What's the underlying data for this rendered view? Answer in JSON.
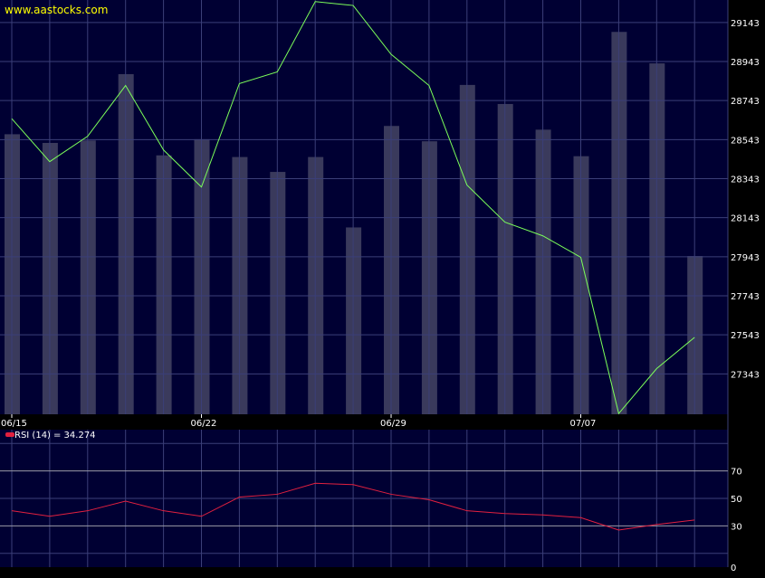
{
  "watermark": "www.aastocks.com",
  "colors": {
    "background": "#000033",
    "grid": "#3b3f78",
    "price_line": "#7cff5a",
    "volume_bar": "#3a3a5c",
    "rsi_line": "#e2203f",
    "rsi_ref_line": "#9a9aa6",
    "text": "#ffffff",
    "watermark": "#ffff00"
  },
  "chart_data": [
    {
      "type": "line",
      "title": "",
      "price_axis": {
        "ticks": [
          "29143",
          "28943",
          "28743",
          "28543",
          "28343",
          "28143",
          "27943",
          "27743",
          "27543",
          "27343"
        ],
        "ylim": [
          27136,
          29258
        ]
      },
      "date_labels": [
        "06/15",
        "06/22",
        "06/29",
        "07/07"
      ],
      "date_label_index": [
        0,
        5,
        10,
        15
      ],
      "grid": true,
      "series": [
        {
          "values": [
            28650,
            28430,
            28560,
            28820,
            28490,
            28300,
            28830,
            28890,
            29250,
            29230,
            28980,
            28820,
            28310,
            28120,
            28050,
            27940,
            27140,
            27370,
            27530
          ]
        }
      ],
      "volume_bars": [
        0.676,
        0.655,
        0.661,
        0.821,
        0.625,
        0.664,
        0.621,
        0.585,
        0.621,
        0.451,
        0.696,
        0.659,
        0.795,
        0.749,
        0.687,
        0.623,
        0.923,
        0.847,
        0.382
      ]
    },
    {
      "type": "line",
      "legend": "RSI (14)",
      "current_value": "= 34.274",
      "ylim": [
        0,
        100
      ],
      "ticks": [
        "70",
        "50",
        "30",
        "0"
      ],
      "ref_lines": [
        30,
        70
      ],
      "grid": true,
      "series": [
        {
          "name": "RSI (14)",
          "values": [
            41,
            37,
            41,
            48,
            41,
            37,
            51,
            53,
            61,
            60,
            53,
            49,
            41,
            39,
            38,
            36,
            27,
            31,
            34.3
          ]
        }
      ]
    }
  ]
}
